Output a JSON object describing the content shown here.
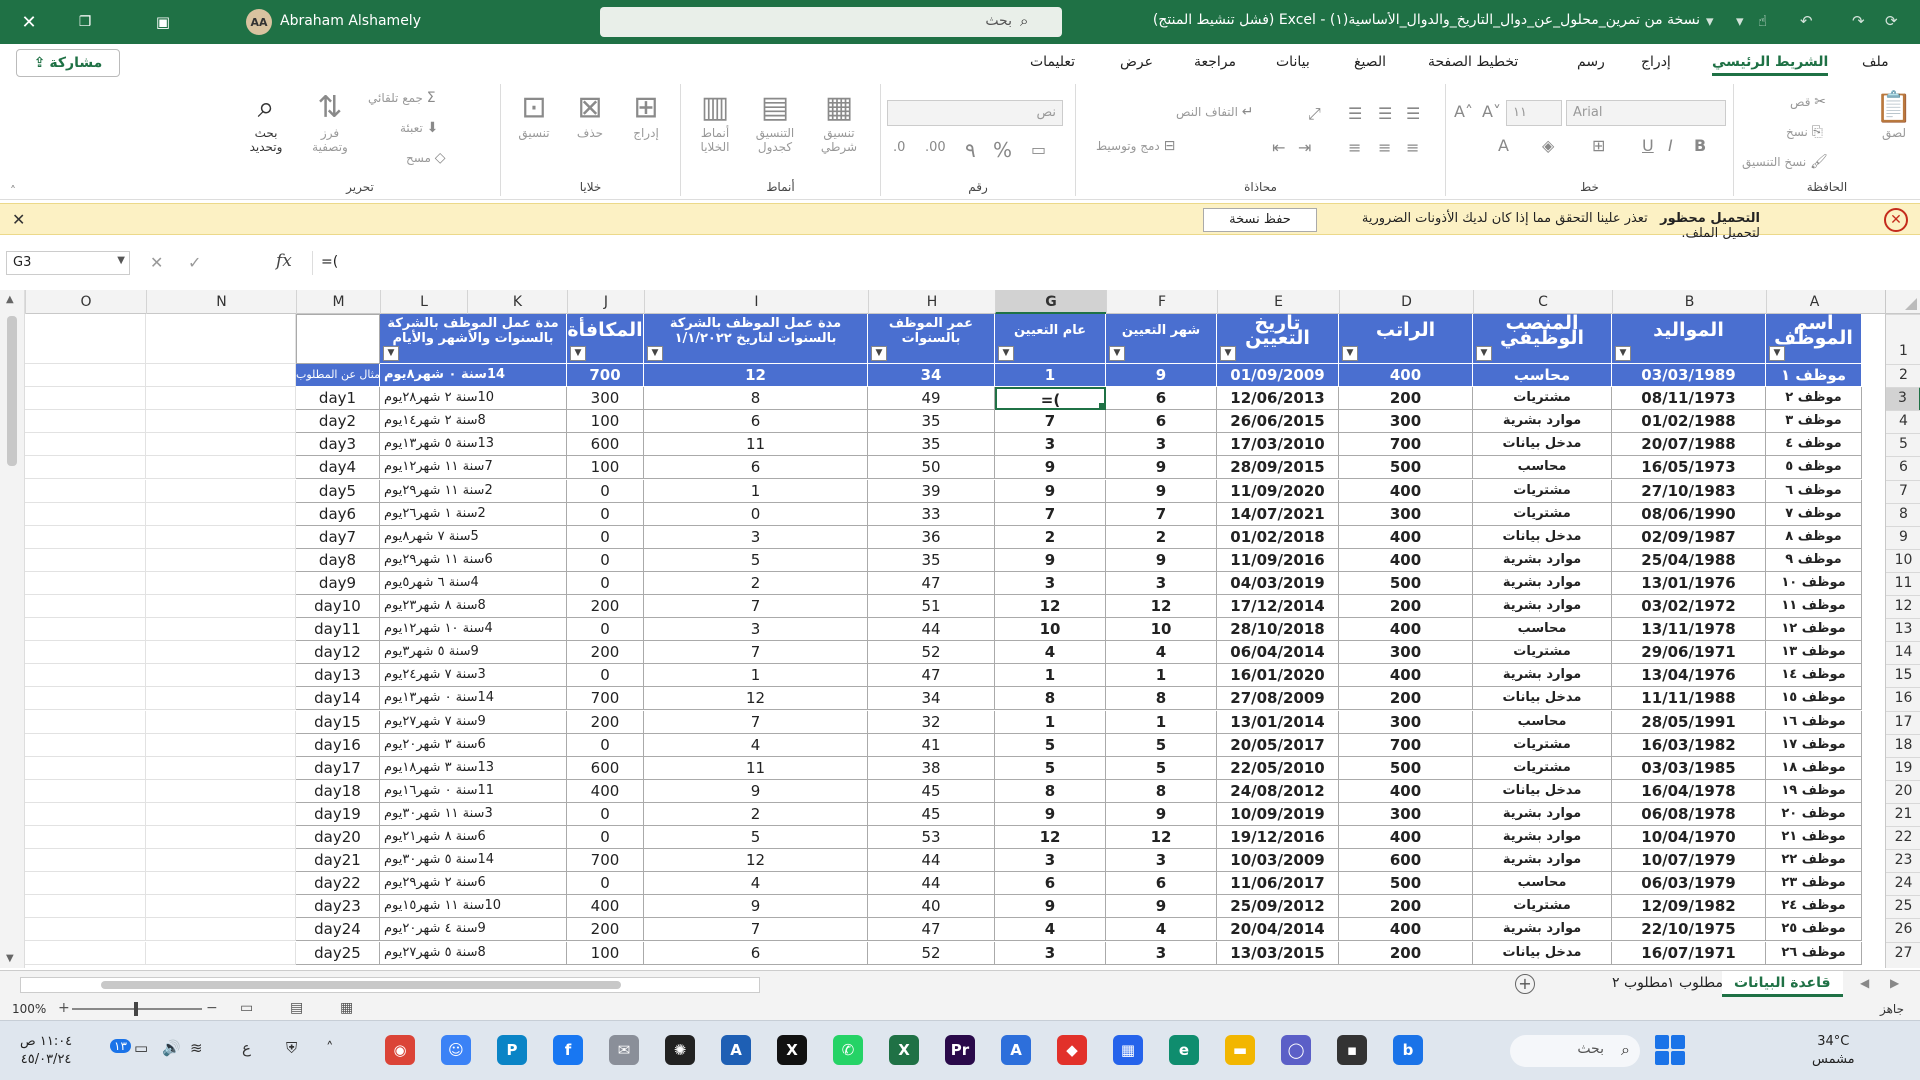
{
  "titlebar": {
    "user_initials": "AA",
    "user_name": "Abraham Alshamely",
    "search_placeholder": "بحث",
    "title": "نسخة من تمرين_محلول_عن_دوال_التاريخ_والدوال_الأساسية(١) - Excel (فشل تنشيط المنتج)"
  },
  "ribbon_tabs": {
    "share": "مشاركة",
    "tabs": [
      "ملف",
      "الشريط الرئيسي",
      "إدراج",
      "رسم",
      "تخطيط الصفحة",
      "الصيغ",
      "بيانات",
      "مراجعة",
      "عرض",
      "تعليمات"
    ],
    "active": "الشريط الرئيسي"
  },
  "ribbon": {
    "clipboard": {
      "label": "الحافظة",
      "paste": "لصق",
      "cut": "قص",
      "copy": "نسخ",
      "format_painter": "نسخ التنسيق"
    },
    "font": {
      "label": "خط",
      "font_name": "Arial",
      "font_size": "١١",
      "bold": "B",
      "italic": "I",
      "underline": "U"
    },
    "alignment": {
      "label": "محاذاة",
      "wrap": "التفاف النص",
      "merge": "دمج وتوسيط"
    },
    "number": {
      "label": "رقم",
      "format": "نص",
      "percent": "%",
      "comma": "٩"
    },
    "styles": {
      "label": "أنماط",
      "conditional": "تنسيق شرطي",
      "as_table": "التنسيق كجدول",
      "cell_styles": "أنماط الخلايا"
    },
    "cells": {
      "label": "خلايا",
      "insert": "إدراج",
      "delete": "حذف",
      "format": "تنسيق"
    },
    "editing": {
      "label": "تحرير",
      "autosum": "جمع تلقائي",
      "fill": "تعبئة",
      "clear": "مسح",
      "sort": "فرز وتصفية",
      "find": "بحث وتحديد"
    }
  },
  "message_bar": {
    "title": "التحميل محظور",
    "text": "تعذر علينا التحقق مما إذا كان لديك الأذونات الضرورية لتحميل الملف.",
    "button": "حفظ نسخة"
  },
  "formula_bar": {
    "name_box": "G3",
    "formula": "=("
  },
  "grid": {
    "columns": [
      "A",
      "B",
      "C",
      "D",
      "E",
      "F",
      "G",
      "H",
      "I",
      "J",
      "K",
      "L",
      "M",
      "N",
      "O"
    ],
    "selected_column": "G",
    "row_numbers": [
      "1",
      "2",
      "3",
      "4",
      "5",
      "6",
      "7",
      "8",
      "9",
      "10",
      "11",
      "12",
      "13",
      "14",
      "15",
      "16",
      "17",
      "18",
      "19",
      "20",
      "21",
      "22",
      "23",
      "24",
      "25",
      "26",
      "27"
    ],
    "selected_row": "3",
    "headers": {
      "a": "اسم الموظف",
      "b": "المواليد",
      "c": "المنصب الوظيفي",
      "d": "الراتب",
      "e": "تاريخ التعيين",
      "f": "شهر التعيين",
      "g": "عام التعيين",
      "h": "عمر الموظف بالسنوات",
      "i": "مدة عمل الموظف بالشركة بالسنوات لتاريخ ١/١/٢٠٢٢",
      "j": "المكافأة",
      "kl": "مدة عمل الموظف بالشركة بالسنوات والأشهر والأيام"
    },
    "example_note": "مثال عن المطلوب",
    "active_cell_text": "=(",
    "rows": [
      [
        "موظف ١",
        "03/03/1989",
        "محاسب",
        "400",
        "01/09/2009",
        "9",
        "1",
        "34",
        "12",
        "700",
        "14سنة ٠ شهر٨يوم",
        ""
      ],
      [
        "موظف ٢",
        "08/11/1973",
        "مشتريات",
        "200",
        "12/06/2013",
        "6",
        "=(",
        "49",
        "8",
        "300",
        "10سنة ٢ شهر٢٨يوم",
        "day1"
      ],
      [
        "موظف ٣",
        "01/02/1988",
        "موارد بشرية",
        "300",
        "26/06/2015",
        "6",
        "7",
        "35",
        "6",
        "100",
        "8سنة ٢ شهر١٤يوم",
        "day2"
      ],
      [
        "موظف ٤",
        "20/07/1988",
        "مدخل بيانات",
        "700",
        "17/03/2010",
        "3",
        "3",
        "35",
        "11",
        "600",
        "13سنة ٥ شهر١٣يوم",
        "day3"
      ],
      [
        "موظف ٥",
        "16/05/1973",
        "محاسب",
        "500",
        "28/09/2015",
        "9",
        "9",
        "50",
        "6",
        "100",
        "7سنة ١١ شهر١٢يوم",
        "day4"
      ],
      [
        "موظف ٦",
        "27/10/1983",
        "مشتريات",
        "400",
        "11/09/2020",
        "9",
        "9",
        "39",
        "1",
        "0",
        "2سنة ١١ شهر٢٩يوم",
        "day5"
      ],
      [
        "موظف ٧",
        "08/06/1990",
        "مشتريات",
        "300",
        "14/07/2021",
        "7",
        "7",
        "33",
        "0",
        "0",
        "2سنة ١ شهر٢٦يوم",
        "day6"
      ],
      [
        "موظف ٨",
        "02/09/1987",
        "مدخل بيانات",
        "400",
        "01/02/2018",
        "2",
        "2",
        "36",
        "3",
        "0",
        "5سنة ٧ شهر٨يوم",
        "day7"
      ],
      [
        "موظف ٩",
        "25/04/1988",
        "موارد بشرية",
        "400",
        "11/09/2016",
        "9",
        "9",
        "35",
        "5",
        "0",
        "6سنة ١١ شهر٢٩يوم",
        "day8"
      ],
      [
        "موظف ١٠",
        "13/01/1976",
        "موارد بشرية",
        "500",
        "04/03/2019",
        "3",
        "3",
        "47",
        "2",
        "0",
        "4سنة ٦ شهر٥يوم",
        "day9"
      ],
      [
        "موظف ١١",
        "03/02/1972",
        "موارد بشرية",
        "200",
        "17/12/2014",
        "12",
        "12",
        "51",
        "7",
        "200",
        "8سنة ٨ شهر٢٣يوم",
        "day10"
      ],
      [
        "موظف ١٢",
        "13/11/1978",
        "محاسب",
        "400",
        "28/10/2018",
        "10",
        "10",
        "44",
        "3",
        "0",
        "4سنة ١٠ شهر١٢يوم",
        "day11"
      ],
      [
        "موظف ١٣",
        "29/06/1971",
        "مشتريات",
        "300",
        "06/04/2014",
        "4",
        "4",
        "52",
        "7",
        "200",
        "9سنة ٥ شهر٣يوم",
        "day12"
      ],
      [
        "موظف ١٤",
        "13/04/1976",
        "موارد بشرية",
        "400",
        "16/01/2020",
        "1",
        "1",
        "47",
        "1",
        "0",
        "3سنة ٧ شهر٢٤يوم",
        "day13"
      ],
      [
        "موظف ١٥",
        "11/11/1988",
        "مدخل بيانات",
        "200",
        "27/08/2009",
        "8",
        "8",
        "34",
        "12",
        "700",
        "14سنة ٠ شهر١٣يوم",
        "day14"
      ],
      [
        "موظف ١٦",
        "28/05/1991",
        "محاسب",
        "300",
        "13/01/2014",
        "1",
        "1",
        "32",
        "7",
        "200",
        "9سنة ٧ شهر٢٧يوم",
        "day15"
      ],
      [
        "موظف ١٧",
        "16/03/1982",
        "مشتريات",
        "700",
        "20/05/2017",
        "5",
        "5",
        "41",
        "4",
        "0",
        "6سنة ٣ شهر٢٠يوم",
        "day16"
      ],
      [
        "موظف ١٨",
        "03/03/1985",
        "مشتريات",
        "500",
        "22/05/2010",
        "5",
        "5",
        "38",
        "11",
        "600",
        "13سنة ٣ شهر١٨يوم",
        "day17"
      ],
      [
        "موظف ١٩",
        "16/04/1978",
        "مدخل بيانات",
        "400",
        "24/08/2012",
        "8",
        "8",
        "45",
        "9",
        "400",
        "11سنة ٠ شهر١٦يوم",
        "day18"
      ],
      [
        "موظف ٢٠",
        "06/08/1978",
        "موارد بشرية",
        "300",
        "10/09/2019",
        "9",
        "9",
        "45",
        "2",
        "0",
        "3سنة ١١ شهر٣٠يوم",
        "day19"
      ],
      [
        "موظف ٢١",
        "10/04/1970",
        "موارد بشرية",
        "400",
        "19/12/2016",
        "12",
        "12",
        "53",
        "5",
        "0",
        "6سنة ٨ شهر٢١يوم",
        "day20"
      ],
      [
        "موظف ٢٢",
        "10/07/1979",
        "موارد بشرية",
        "600",
        "10/03/2009",
        "3",
        "3",
        "44",
        "12",
        "700",
        "14سنة ٥ شهر٣٠يوم",
        "day21"
      ],
      [
        "موظف ٢٣",
        "06/03/1979",
        "محاسب",
        "500",
        "11/06/2017",
        "6",
        "6",
        "44",
        "4",
        "0",
        "6سنة ٢ شهر٢٩يوم",
        "day22"
      ],
      [
        "موظف ٢٤",
        "12/09/1982",
        "مشتريات",
        "200",
        "25/09/2012",
        "9",
        "9",
        "40",
        "9",
        "400",
        "10سنة ١١ شهر١٥يوم",
        "day23"
      ],
      [
        "موظف ٢٥",
        "22/10/1975",
        "موارد بشرية",
        "400",
        "20/04/2014",
        "4",
        "4",
        "47",
        "7",
        "200",
        "9سنة ٤ شهر٢٠يوم",
        "day24"
      ],
      [
        "موظف ٢٦",
        "16/07/1971",
        "مدخل بيانات",
        "200",
        "13/03/2015",
        "3",
        "3",
        "52",
        "6",
        "100",
        "8سنة ٥ شهر٢٧يوم",
        "day25"
      ]
    ]
  },
  "sheets": {
    "tabs": [
      "قاعدة البيانات",
      "مطلوب ١",
      "مطلوب ٢"
    ],
    "active": "قاعدة البيانات"
  },
  "status": {
    "ready": "جاهز",
    "zoom": "100%"
  },
  "taskbar": {
    "time": "١١:٠٤ ص",
    "date": "٤٥/٠٣/٢٤",
    "lang": "ع",
    "badge": "١٣",
    "search": "بحث",
    "temp": "34°C",
    "weather": "مشمس",
    "apps": [
      {
        "icon": "chrome-icon",
        "glyph": "◉",
        "color": "#db4437"
      },
      {
        "icon": "bot-icon",
        "glyph": "☺",
        "color": "#3b82f6"
      },
      {
        "icon": "publisher-icon",
        "glyph": "P",
        "color": "#0a84c6"
      },
      {
        "icon": "facebook-icon",
        "glyph": "f",
        "color": "#1877f2"
      },
      {
        "icon": "mail-icon",
        "glyph": "✉",
        "color": "#8a8f99"
      },
      {
        "icon": "chatgpt-icon",
        "glyph": "✺",
        "color": "#222"
      },
      {
        "icon": "people-icon",
        "glyph": "A",
        "color": "#1e5fb4"
      },
      {
        "icon": "x-icon",
        "glyph": "X",
        "color": "#111"
      },
      {
        "icon": "whatsapp-icon",
        "glyph": "✆",
        "color": "#25d366"
      },
      {
        "icon": "excel-icon",
        "glyph": "X",
        "color": "#1f7145"
      },
      {
        "icon": "premiere-icon",
        "glyph": "Pr",
        "color": "#2a0a4a"
      },
      {
        "icon": "translate-icon",
        "glyph": "A",
        "color": "#2d6fdb"
      },
      {
        "icon": "anydesk-icon",
        "glyph": "◆",
        "color": "#e2312a"
      },
      {
        "icon": "store-icon",
        "glyph": "▦",
        "color": "#2563eb"
      },
      {
        "icon": "edge-icon",
        "glyph": "e",
        "color": "#0f8d6e"
      },
      {
        "icon": "folder-icon",
        "glyph": "▬",
        "color": "#f2b600"
      },
      {
        "icon": "chat-icon",
        "glyph": "◯",
        "color": "#5b5fc7"
      },
      {
        "icon": "terminal-icon",
        "glyph": "▪",
        "color": "#333"
      },
      {
        "icon": "bing-icon",
        "glyph": "b",
        "color": "#1a73e8"
      }
    ]
  },
  "colors": {
    "excel_green": "#1f7145",
    "header_blue": "#4a6fd0",
    "message_yellow": "#fcf1c4"
  }
}
